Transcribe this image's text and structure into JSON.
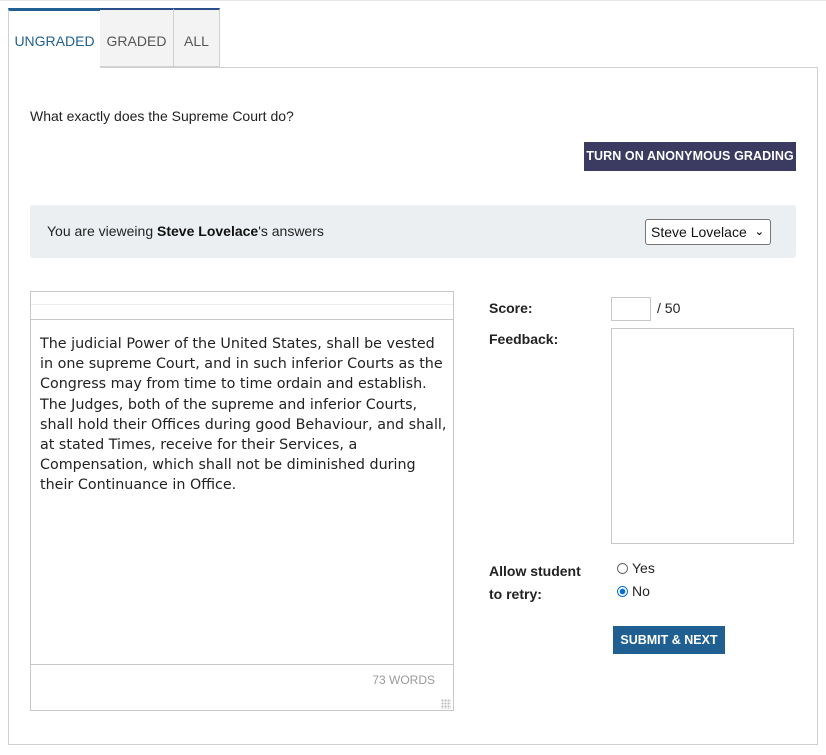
{
  "tabs": [
    {
      "label": "UNGRADED",
      "active": true
    },
    {
      "label": "GRADED",
      "active": false
    },
    {
      "label": "ALL",
      "active": false
    }
  ],
  "question": "What exactly does the Supreme Court do?",
  "anonymous_button": "TURN ON ANONYMOUS GRADING",
  "viewing": {
    "prefix": "You are vieweing ",
    "student_name": "Steve Lovelace",
    "suffix": "'s answers",
    "selected_student": "Steve Lovelace"
  },
  "answer": {
    "text": "The judicial Power of the United States, shall be vested in one supreme Court, and in such inferior Courts as the Congress may from time to time ordain and establish. The Judges, both of the supreme and inferior Courts, shall hold their Offices during good Behaviour, and shall, at stated Times, receive for their Services, a Compensation, which shall not be diminished during their Continuance in Office.",
    "word_count": "73 WORDS"
  },
  "grading": {
    "score_label": "Score:",
    "score_value": "",
    "score_max": "/ 50",
    "feedback_label": "Feedback:",
    "feedback_value": "",
    "retry_label_line1": "Allow student",
    "retry_label_line2": "to retry:",
    "retry_options": [
      {
        "label": "Yes",
        "checked": false
      },
      {
        "label": "No",
        "checked": true
      }
    ],
    "submit_label": "SUBMIT & NEXT"
  },
  "colors": {
    "tab_active": "#1f5f92",
    "anonymous_button_bg": "#3b3a60",
    "submit_button_bg": "#1f5f92",
    "viewing_bar_bg": "#eceff1"
  }
}
